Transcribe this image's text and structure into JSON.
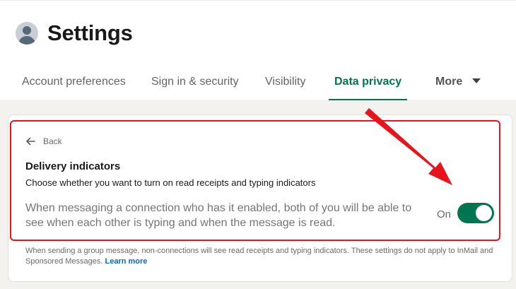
{
  "header": {
    "title": "Settings"
  },
  "tabs": [
    {
      "label": "Account preferences"
    },
    {
      "label": "Sign in & security"
    },
    {
      "label": "Visibility"
    },
    {
      "label": "Data privacy"
    },
    {
      "label": "More"
    }
  ],
  "active_tab": "Data privacy",
  "panel": {
    "back_label": "Back",
    "heading": "Delivery indicators",
    "subheading": "Choose whether you want to turn on read receipts and typing indicators",
    "description": "When messaging a connection who has it enabled, both of you will be able to see when each other is typing and when the message is read.",
    "toggle_label": "On",
    "toggle_state": "on"
  },
  "footnote": {
    "text": "When sending a group message, non-connections will see read receipts and typing indicators. These settings do not apply to InMail and Sponsored Messages. ",
    "link": "Learn more"
  },
  "colors": {
    "accent": "#01754f",
    "link": "#0a66c2",
    "annotation": "#e8131b"
  },
  "icons": {
    "avatar": "person-avatar-icon",
    "back": "arrow-left-icon",
    "more": "caret-down-icon"
  }
}
